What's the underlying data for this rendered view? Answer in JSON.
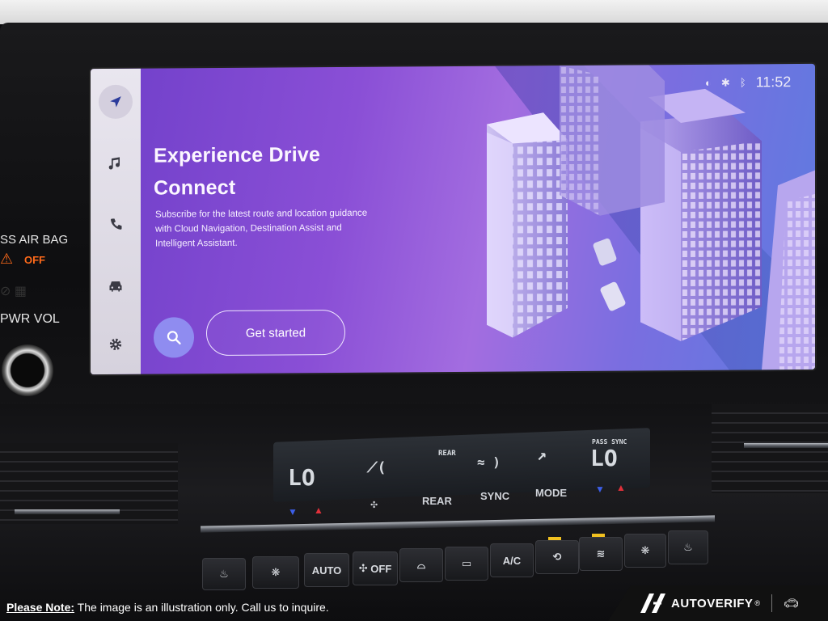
{
  "dashboard": {
    "airbag_label": "SS AIR BAG",
    "airbag_status": "OFF",
    "pwr_vol_label": "PWR VOL"
  },
  "screen": {
    "rail": {
      "items": [
        {
          "icon": "navigation-arrow-icon",
          "active": true
        },
        {
          "icon": "music-note-icon",
          "active": false
        },
        {
          "icon": "phone-icon",
          "active": false
        },
        {
          "icon": "car-icon",
          "active": false
        },
        {
          "icon": "gear-icon",
          "active": false
        }
      ]
    },
    "status_bar": {
      "time": "11:52",
      "icons": [
        "mic-off-icon",
        "voice-assistant-icon",
        "bluetooth-icon"
      ]
    },
    "title_line1": "Experience Drive",
    "title_line2": "Connect",
    "description": "Subscribe for the latest route and location guidance with Cloud Navigation, Destination Assist and Intelligent Assistant.",
    "search_button_icon": "search-icon",
    "cta_label": "Get started",
    "colors": {
      "accent": "#8f8cf0",
      "background_start": "#6f3fc9",
      "background_end": "#5e7be0"
    }
  },
  "climate": {
    "left_temp": "LO",
    "right_temp": "LO",
    "center_rear": "REAR",
    "pass_sync": "PASS SYNC",
    "labels": {
      "rear": "REAR",
      "sync": "SYNC",
      "mode": "MODE"
    },
    "buttons": [
      "AUTO",
      "OFF",
      "A/C"
    ]
  },
  "footer": {
    "note_label": "Please Note:",
    "note_text": " The image is an illustration only. Call us to inquire.",
    "brand_name": "AUTOVERIFY",
    "brand_mark": "®"
  }
}
